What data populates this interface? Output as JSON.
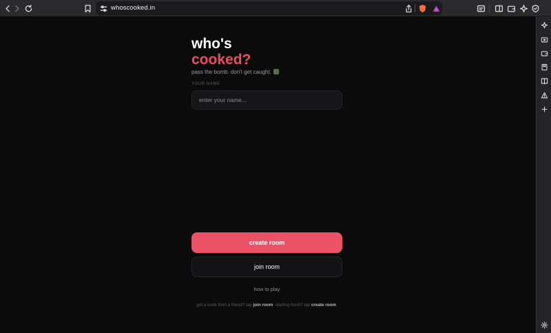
{
  "browser": {
    "url": "whoscooked.in",
    "icons": [
      "back-icon",
      "forward-icon",
      "reload-icon",
      "bookmark-icon",
      "site-settings-icon",
      "share-icon",
      "brave-shields-icon",
      "brave-rewards-icon",
      "reader-icon",
      "sidebar-toggle-icon",
      "wallet-icon",
      "leo-icon",
      "vpn-icon"
    ]
  },
  "side_panel": {
    "icons": [
      "leo-icon",
      "media-icon",
      "wallet-icon",
      "bookmarks-icon",
      "reading-list-icon",
      "alert-icon",
      "add-icon",
      "settings-icon"
    ]
  },
  "page": {
    "title_line1": "who's",
    "title_line2": "cooked?",
    "tagline": "pass the bomb. don't get caught.",
    "name_label": "YOUR NAME",
    "name_placeholder": "enter your name...",
    "name_value": "",
    "create_label": "create room",
    "join_label": "join room",
    "how_to_label": "how to play",
    "help_1": "got a code from a friend? tap ",
    "help_join": "join room",
    "help_2": ". starting fresh? tap ",
    "help_create": "create room",
    "help_3": "."
  },
  "colors": {
    "accent": "#ec5266",
    "background": "#0b0b0c",
    "input_bg": "#161618"
  }
}
